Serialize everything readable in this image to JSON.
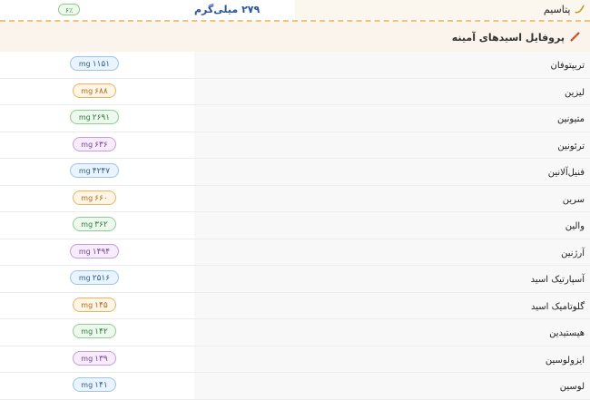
{
  "top_row": {
    "name": "پتاسیم",
    "value": "۲۷۹ میلی‌گرم",
    "badge": "۶٪"
  },
  "section": {
    "title": "پروفایل اسیدهای آمینه",
    "icon": "dna-icon"
  },
  "amino_acids": [
    {
      "name": "تریپتوفان",
      "amount": "۱۱۵۱",
      "unit": "mg",
      "color": "blue"
    },
    {
      "name": "لیزین",
      "amount": "۶۸۸",
      "unit": "mg",
      "color": "orange"
    },
    {
      "name": "متیونین",
      "amount": "۲۶۹۱",
      "unit": "mg",
      "color": "green"
    },
    {
      "name": "ترئونین",
      "amount": "۶۳۶",
      "unit": "mg",
      "color": "purple"
    },
    {
      "name": "فنیل‌آلانین",
      "amount": "۴۲۴۷",
      "unit": "mg",
      "color": "blue"
    },
    {
      "name": "سرین",
      "amount": "۶۶۰",
      "unit": "mg",
      "color": "orange"
    },
    {
      "name": "والین",
      "amount": "۳۶۲",
      "unit": "mg",
      "color": "green"
    },
    {
      "name": "آرژنین",
      "amount": "۱۴۹۴",
      "unit": "mg",
      "color": "purple"
    },
    {
      "name": "آسپارتیک اسید",
      "amount": "۲۵۱۶",
      "unit": "mg",
      "color": "blue"
    },
    {
      "name": "گلوتامیک اسید",
      "amount": "۱۴۵",
      "unit": "mg",
      "color": "orange"
    },
    {
      "name": "هیستیدین",
      "amount": "۱۴۲",
      "unit": "mg",
      "color": "green"
    },
    {
      "name": "ایزولوسین",
      "amount": "۱۳۹",
      "unit": "mg",
      "color": "purple"
    },
    {
      "name": "لوسین",
      "amount": "۱۴۱",
      "unit": "mg",
      "color": "blue"
    }
  ]
}
